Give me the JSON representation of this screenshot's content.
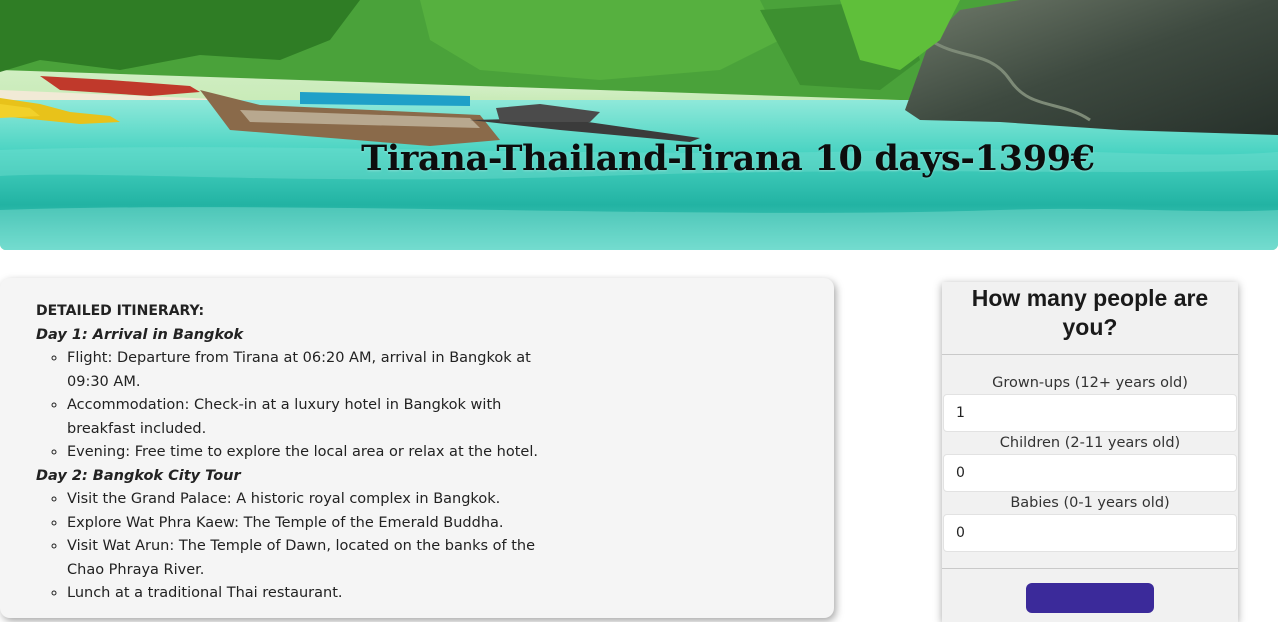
{
  "hero": {
    "title": "Tirana-Thailand-Tirana 10 days-1399€"
  },
  "itinerary": {
    "heading": "DETAILED ITINERARY:",
    "days": [
      {
        "title": "Day 1: Arrival in Bangkok",
        "activities": [
          "Flight: Departure from Tirana at 06:20 AM, arrival in Bangkok at 09:30 AM.",
          "Accommodation: Check-in at a luxury hotel in Bangkok with breakfast included.",
          "Evening: Free time to explore the local area or relax at the hotel."
        ]
      },
      {
        "title": "Day 2: Bangkok City Tour",
        "activities": [
          "Visit the Grand Palace: A historic royal complex in Bangkok.",
          "Explore Wat Phra Kaew: The Temple of the Emerald Buddha.",
          "Visit Wat Arun: The Temple of Dawn, located on the banks of the Chao Phraya River.",
          "Lunch at a traditional Thai restaurant."
        ]
      }
    ]
  },
  "booking_form": {
    "title": "How many people are you?",
    "fields": [
      {
        "label": "Grown-ups (12+ years old)",
        "value": "1"
      },
      {
        "label": "Children (2-11 years old)",
        "value": "0"
      },
      {
        "label": "Babies (0-1 years old)",
        "value": "0"
      }
    ],
    "submit_label": ""
  },
  "colors": {
    "water": "#3fd1c0",
    "foliage": "#3f9a2c",
    "card_bg": "#f5f5f5",
    "button": "#3b2a9a"
  }
}
